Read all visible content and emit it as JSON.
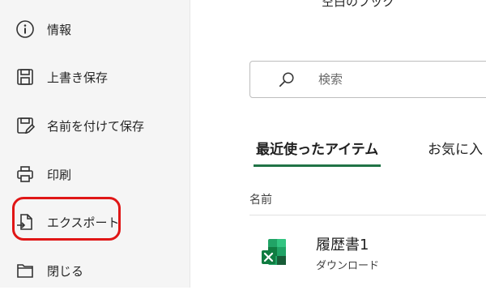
{
  "sidebar": {
    "items": [
      {
        "label": "情報",
        "icon": "info-icon"
      },
      {
        "label": "上書き保存",
        "icon": "save-icon"
      },
      {
        "label": "名前を付けて保存",
        "icon": "save-as-icon"
      },
      {
        "label": "印刷",
        "icon": "print-icon"
      },
      {
        "label": "エクスポート",
        "icon": "export-icon"
      },
      {
        "label": "閉じる",
        "icon": "folder-close-icon"
      }
    ]
  },
  "main": {
    "title": "空白のブック",
    "search": {
      "placeholder": "検索",
      "value": ""
    },
    "tabs": [
      {
        "label": "最近使ったアイテム",
        "active": true
      },
      {
        "label": "お気に入",
        "active": false
      }
    ],
    "list_header": "名前",
    "files": [
      {
        "name": "履歴書1",
        "location": "ダウンロード",
        "icon": "excel-icon"
      }
    ]
  },
  "colors": {
    "accent": "#217346",
    "highlight": "#e01616",
    "sidebar_bg": "#f5f5f5"
  }
}
